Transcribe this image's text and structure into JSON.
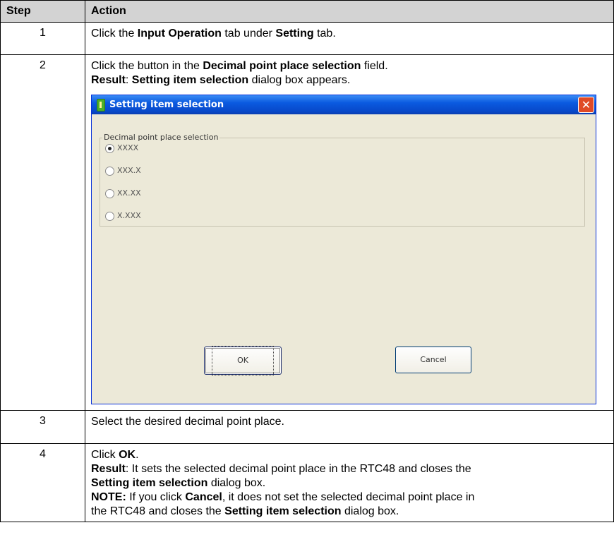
{
  "header": {
    "step": "Step",
    "action": "Action"
  },
  "rows": [
    {
      "num": "1",
      "parts": [
        "Click the ",
        "Input Operation",
        " tab under ",
        "Setting",
        " tab."
      ]
    },
    {
      "num": "2",
      "line1": [
        "Click the button in the ",
        "Decimal point place selection",
        " field."
      ],
      "line2": [
        "Result",
        ": ",
        "Setting item selection",
        " dialog box appears."
      ]
    },
    {
      "num": "3",
      "text": "Select the desired decimal point place."
    },
    {
      "num": "4",
      "line1": [
        "Click ",
        "OK",
        "."
      ],
      "line2": [
        "Result",
        ": It sets the selected decimal point place in the RTC48 and closes the"
      ],
      "line3": [
        "Setting item selection",
        " dialog box."
      ],
      "line4": [
        "NOTE:",
        " If you click ",
        "Cancel",
        ", it does not set the selected decimal point place in"
      ],
      "line5": [
        "the RTC48 and closes the ",
        "Setting item selection",
        " dialog box."
      ]
    }
  ],
  "dialog": {
    "title": "Setting item selection",
    "close_glyph": "✕",
    "group_label": "Decimal point place selection",
    "options": [
      {
        "label": "XXXX",
        "selected": true
      },
      {
        "label": "XXX.X",
        "selected": false
      },
      {
        "label": "XX.XX",
        "selected": false
      },
      {
        "label": "X.XXX",
        "selected": false
      }
    ],
    "ok_label": "OK",
    "cancel_label": "Cancel"
  }
}
